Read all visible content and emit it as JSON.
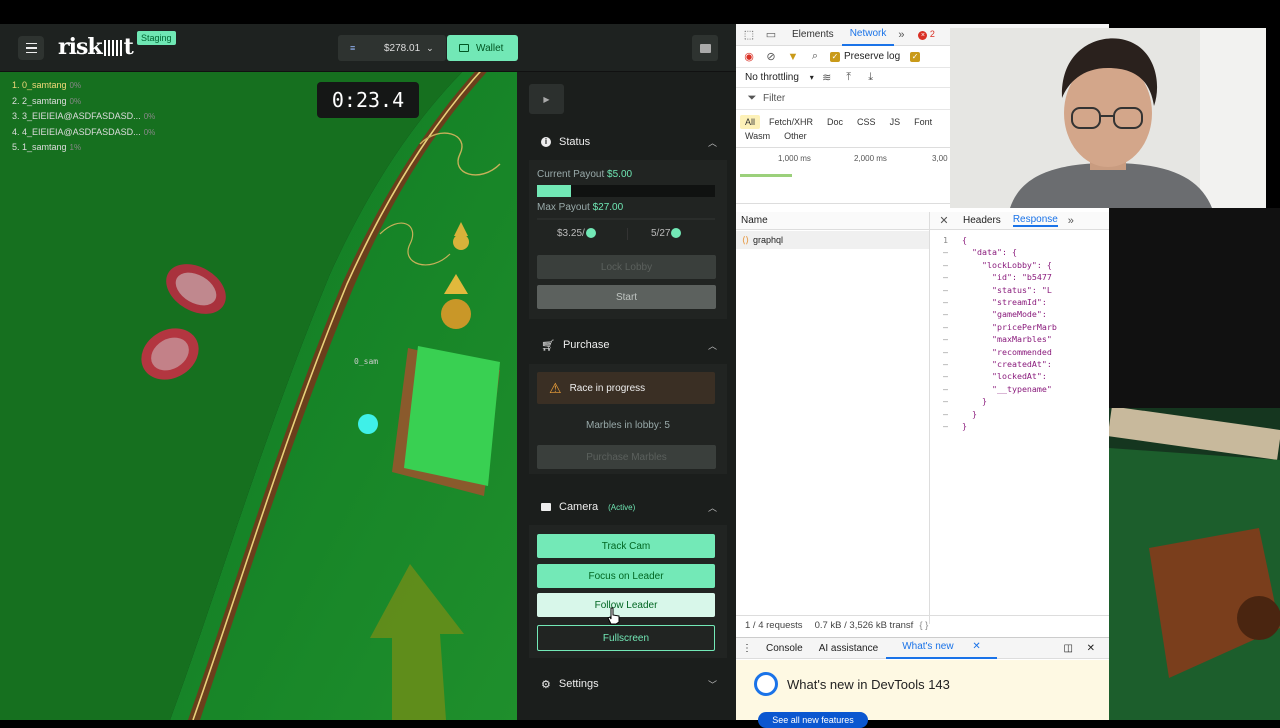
{
  "topbar": {
    "logo_text": "risk",
    "staging_badge": "Staging",
    "balance": "$278.01",
    "wallet_label": "Wallet"
  },
  "game": {
    "timer": "0:23.4",
    "marble_label": "0_sam",
    "leaderboard": [
      {
        "label": "1. 0_samtang",
        "pct": "0%"
      },
      {
        "label": "2. 2_samtang",
        "pct": "0%"
      },
      {
        "label": "3. 3_EIEIEIA@ASDFASDASD...",
        "pct": "0%"
      },
      {
        "label": "4. 4_EIEIEIA@ASDFASDASD...",
        "pct": "0%"
      },
      {
        "label": "5. 1_samtang",
        "pct": "1%"
      }
    ]
  },
  "panel": {
    "play_icon": "play-icon",
    "status": {
      "title": "Status",
      "current_payout_label": "Current Payout",
      "current_payout_value": "$5.00",
      "current_payout_fill": 0.19,
      "max_payout_label": "Max Payout",
      "max_payout_value": "$27.00",
      "max_payout_fill": 0,
      "price": "$3.25/",
      "count": "5/27",
      "lock_lobby": "Lock Lobby",
      "start": "Start"
    },
    "purchase": {
      "title": "Purchase",
      "warning": "Race in progress",
      "marbles_in_lobby": "Marbles in lobby: 5",
      "purchase_button": "Purchase Marbles"
    },
    "camera": {
      "title": "Camera",
      "active": "(Active)",
      "track_cam": "Track Cam",
      "focus_on_leader": "Focus on Leader",
      "follow_leader": "Follow Leader",
      "fullscreen": "Fullscreen"
    },
    "settings": {
      "title": "Settings"
    }
  },
  "devtools": {
    "tabs": [
      "Elements",
      "Network"
    ],
    "error_count": "2",
    "preserve_log": "Preserve log",
    "throttling": "No throttling",
    "filter_placeholder": "Filter",
    "types_row1": [
      "All",
      "Fetch/XHR",
      "Doc",
      "CSS",
      "JS",
      "Font"
    ],
    "types_row2": [
      "Wasm",
      "Other"
    ],
    "timeline": [
      "1,000 ms",
      "2,000 ms",
      "3,00"
    ],
    "name_header": "Name",
    "detail_tabs": [
      "Headers",
      "Response"
    ],
    "request_name": "graphql",
    "status_requests": "1 / 4 requests",
    "status_transfer": "0.7 kB / 3,526 kB transf",
    "drawer_tabs": [
      "Console",
      "AI assistance",
      "What's new"
    ],
    "whats_new_title": "What's new in DevTools 143",
    "whats_new_button": "See all new features",
    "response_lines": [
      {
        "ln": "1",
        "text": "{"
      },
      {
        "ln": "–",
        "text": "  \"data\": {"
      },
      {
        "ln": "–",
        "text": "    \"lockLobby\": {"
      },
      {
        "ln": "–",
        "text": "      \"id\": \"b5477"
      },
      {
        "ln": "–",
        "text": "      \"status\": \"L"
      },
      {
        "ln": "–",
        "text": "      \"streamId\": "
      },
      {
        "ln": "–",
        "text": "      \"gameMode\": "
      },
      {
        "ln": "–",
        "text": "      \"pricePerMarb"
      },
      {
        "ln": "–",
        "text": "      \"maxMarbles\""
      },
      {
        "ln": "–",
        "text": "      \"recommended"
      },
      {
        "ln": "–",
        "text": "      \"createdAt\":"
      },
      {
        "ln": "–",
        "text": "      \"lockedAt\": "
      },
      {
        "ln": "–",
        "text": "      \"__typename\""
      },
      {
        "ln": "–",
        "text": "    }"
      },
      {
        "ln": "–",
        "text": "  }"
      },
      {
        "ln": "–",
        "text": "}"
      }
    ]
  },
  "colors": {
    "accent": "#72e8b6",
    "felt": "#1a7a2c",
    "devtools_blue": "#1a73e8"
  }
}
